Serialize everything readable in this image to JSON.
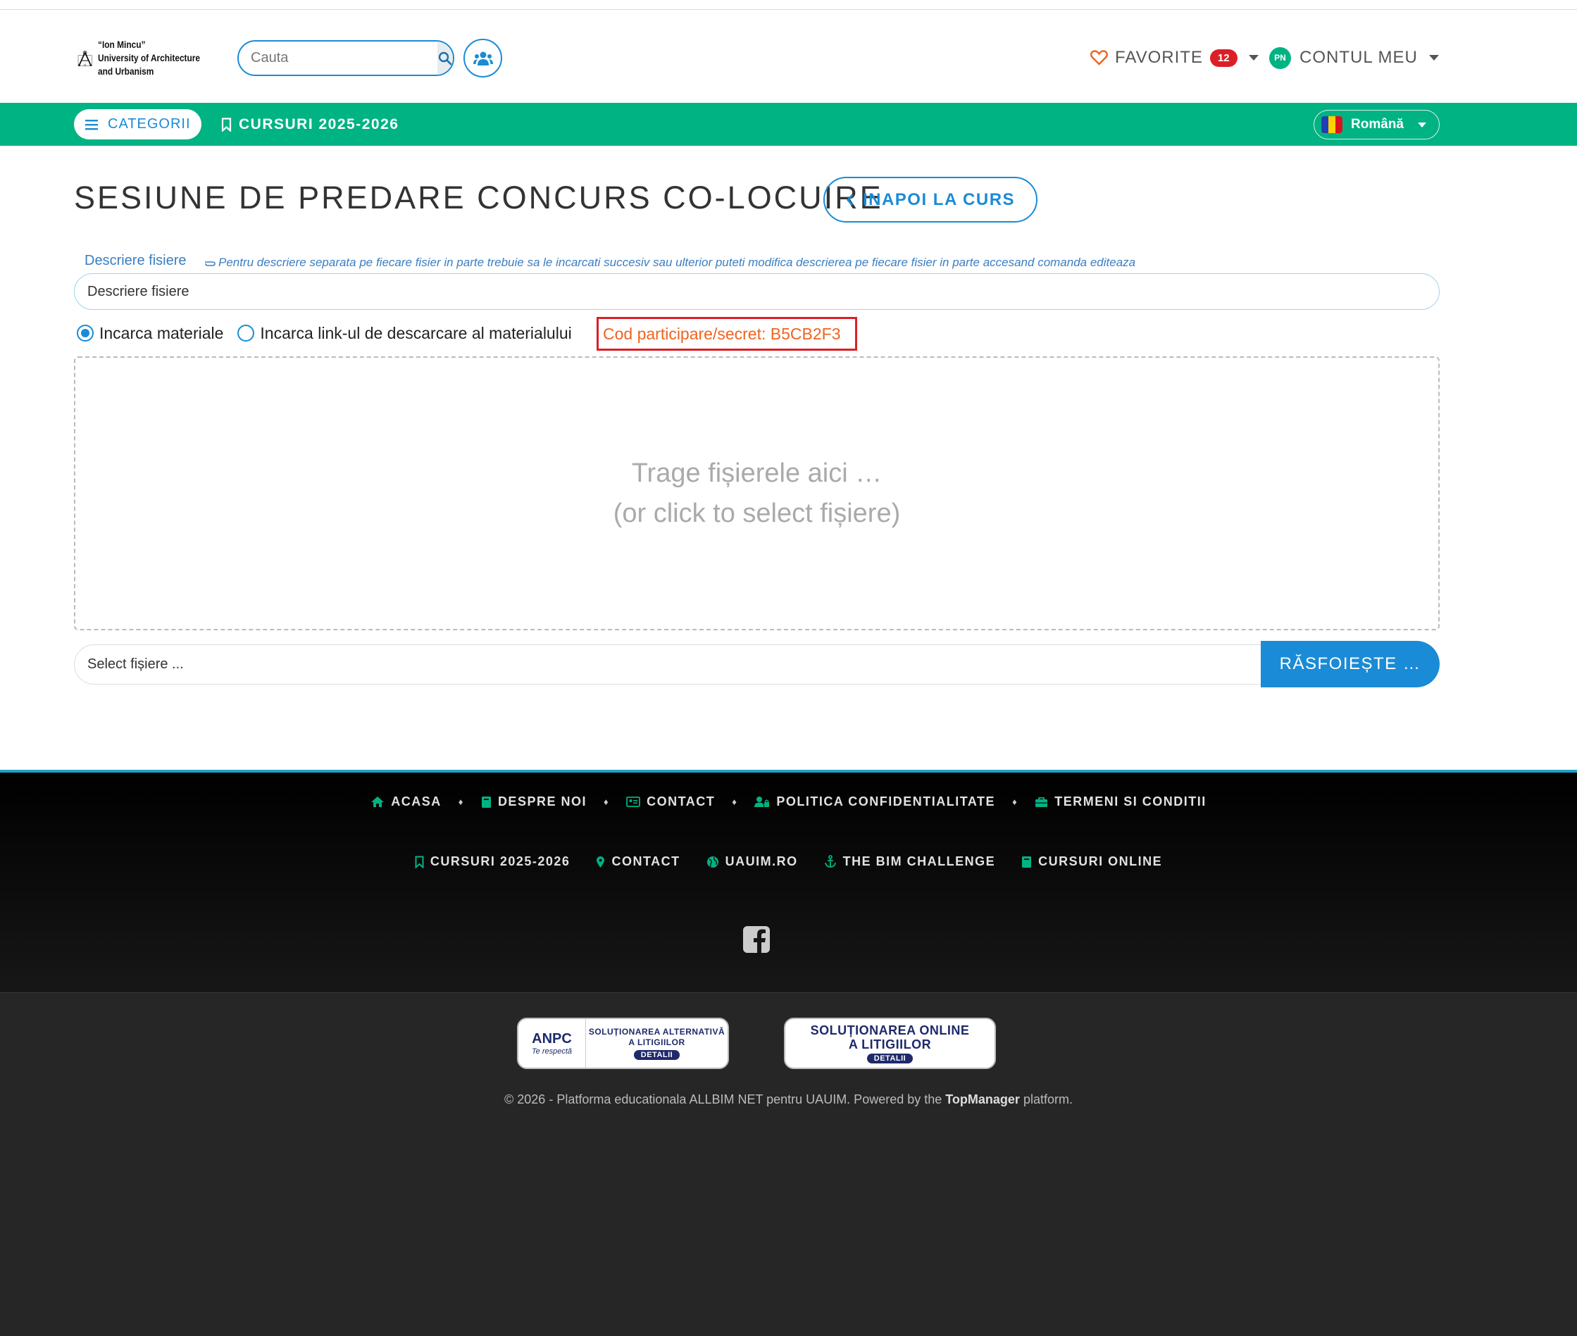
{
  "header": {
    "logo_text": [
      "“Ion Mincu”",
      "University of Architecture",
      "and Urbanism"
    ],
    "search": {
      "placeholder": "Cauta",
      "icon": "search-icon"
    },
    "users_icon": "users-icon",
    "favorites": {
      "label": "FAVORITE",
      "count": "12",
      "icon": "heart-icon"
    },
    "account": {
      "initials": "PN",
      "label": "CONTUL MEU"
    }
  },
  "navbar": {
    "categories_label": "CATEGORII",
    "courses_label": "CURSURI 2025-2026",
    "language": "Română"
  },
  "page": {
    "title": "SESIUNE DE PREDARE CONCURS CO-LOCUIRE",
    "back_button": "INAPOI LA CURS",
    "description_label": "Descriere fisiere",
    "description_hint": "Pentru descriere separata pe fiecare fisier in parte trebuie sa le incarcati succesiv sau ulterior puteti modifica descrierea pe fiecare fisier in parte accesand comanda editeaza",
    "description_value": "Descriere fisiere",
    "radio_upload": "Incarca materiale",
    "radio_link": "Incarca link-ul de descarcare al materialului",
    "secret_code": "Cod participare/secret: B5CB2F3",
    "dropzone_line1": "Trage fișierele aici …",
    "dropzone_line2": "(or click to select fișiere)",
    "select_placeholder": "Select fișiere ...",
    "browse_button": "RĂSFOIEȘTE …"
  },
  "footer": {
    "nav1": [
      "ACASA",
      "DESPRE NOI",
      "CONTACT",
      "POLITICA CONFIDENTIALITATE",
      "TERMENI SI CONDITII"
    ],
    "nav2": [
      "CURSURI 2025-2026",
      "CONTACT",
      "UAUIM.RO",
      "THE BIM CHALLENGE",
      "CURSURI ONLINE"
    ],
    "sal": {
      "brand": "ANPC",
      "tagline": "Te respectă",
      "title": "SOLUȚIONAREA ALTERNATIVĂ A LITIGIILOR",
      "details": "DETALII"
    },
    "sol": {
      "title": "SOLUȚIONAREA ONLINE A LITIGIILOR",
      "details": "DETALII"
    },
    "copyright_prefix": "© 2026 - Platforma educationala ALLBIM NET pentru UAUIM. Powered by the ",
    "copyright_brand": "TopManager",
    "copyright_suffix": " platform."
  },
  "colors": {
    "accent": "#1a8bd6",
    "green": "#00b383",
    "badge": "#dc1f26",
    "secret": "#f0631e"
  }
}
